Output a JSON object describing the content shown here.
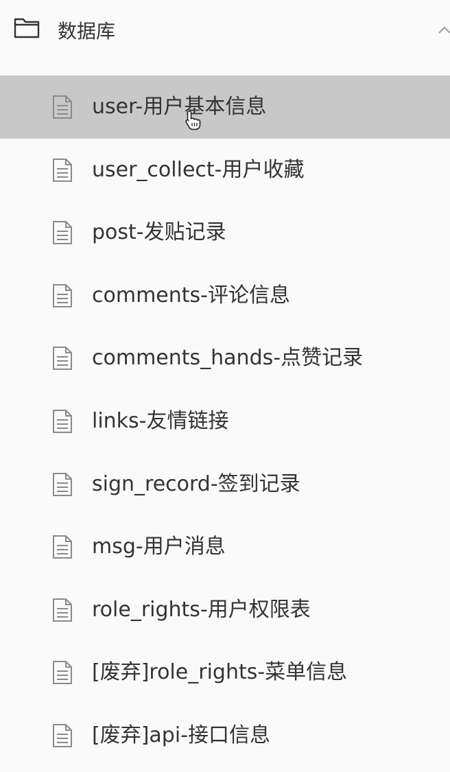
{
  "folder": {
    "title": "数据库",
    "icon": "folder-icon",
    "expanded": true
  },
  "items": [
    {
      "label": "user-用户基本信息",
      "icon": "document-icon",
      "active": true
    },
    {
      "label": "user_collect-用户收藏",
      "icon": "document-icon",
      "active": false
    },
    {
      "label": "post-发贴记录",
      "icon": "document-icon",
      "active": false
    },
    {
      "label": "comments-评论信息",
      "icon": "document-icon",
      "active": false
    },
    {
      "label": "comments_hands-点赞记录",
      "icon": "document-icon",
      "active": false
    },
    {
      "label": "links-友情链接",
      "icon": "document-icon",
      "active": false
    },
    {
      "label": "sign_record-签到记录",
      "icon": "document-icon",
      "active": false
    },
    {
      "label": "msg-用户消息",
      "icon": "document-icon",
      "active": false
    },
    {
      "label": "role_rights-用户权限表",
      "icon": "document-icon",
      "active": false
    },
    {
      "label": "[废弃]role_rights-菜单信息",
      "icon": "document-icon",
      "active": false
    },
    {
      "label": "[废弃]api-接口信息",
      "icon": "document-icon",
      "active": false
    }
  ],
  "colors": {
    "background": "#fafafa",
    "active_background": "#c8c8c8",
    "text": "#333333",
    "icon": "#8a8a8a"
  }
}
